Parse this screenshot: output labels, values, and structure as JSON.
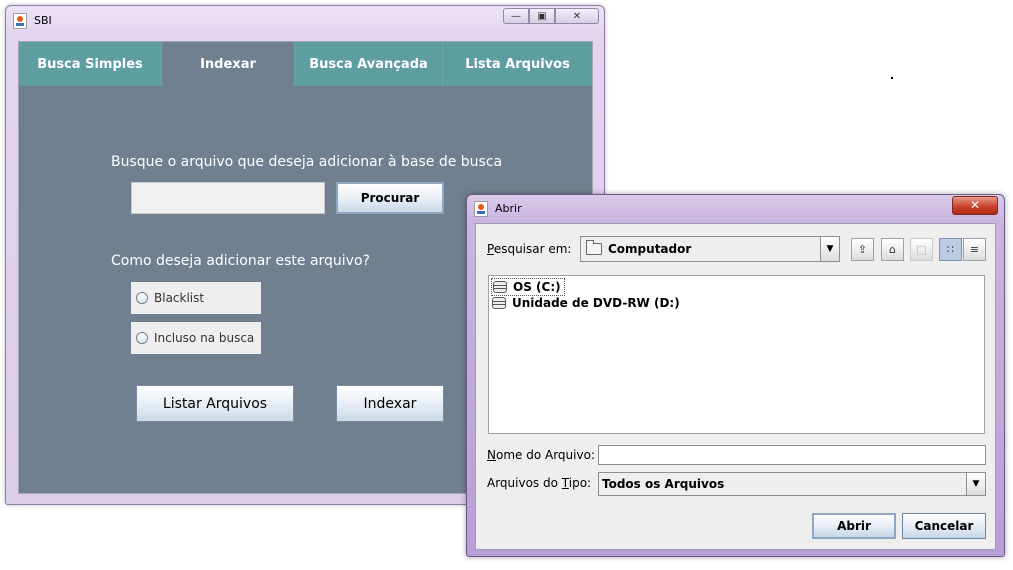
{
  "main_window": {
    "title": "SBI",
    "tabs": [
      {
        "label": "Busca Simples"
      },
      {
        "label": "Indexar"
      },
      {
        "label": "Busca Avançada"
      },
      {
        "label": "Lista Arquivos"
      }
    ],
    "prompt_file": "Busque o arquivo que deseja adicionar à base de busca",
    "search_value": "",
    "browse_label": "Procurar",
    "prompt_mode": "Como deseja adicionar este arquivo?",
    "radio_options": [
      {
        "label": "Blacklist",
        "selected": false
      },
      {
        "label": "Incluso na busca",
        "selected": false
      }
    ],
    "list_button": "Listar Arquivos",
    "index_button": "Indexar"
  },
  "dialog": {
    "title": "Abrir",
    "look_in_label_pre": "",
    "look_in_label_mnemonic": "P",
    "look_in_label_post": "esquisar em:",
    "look_in_value": "Computador",
    "files": [
      {
        "name": "OS (C:)",
        "selected": true
      },
      {
        "name": "Unidade de DVD-RW (D:)",
        "selected": false
      }
    ],
    "name_label_pre": "",
    "name_label_mnemonic": "N",
    "name_label_post": "ome do Arquivo:",
    "name_value": "",
    "type_label_pre": "Arquivos do ",
    "type_label_mnemonic": "T",
    "type_label_post": "ipo:",
    "type_value": "Todos os Arquivos",
    "open_button": "Abrir",
    "cancel_button": "Cancelar"
  }
}
